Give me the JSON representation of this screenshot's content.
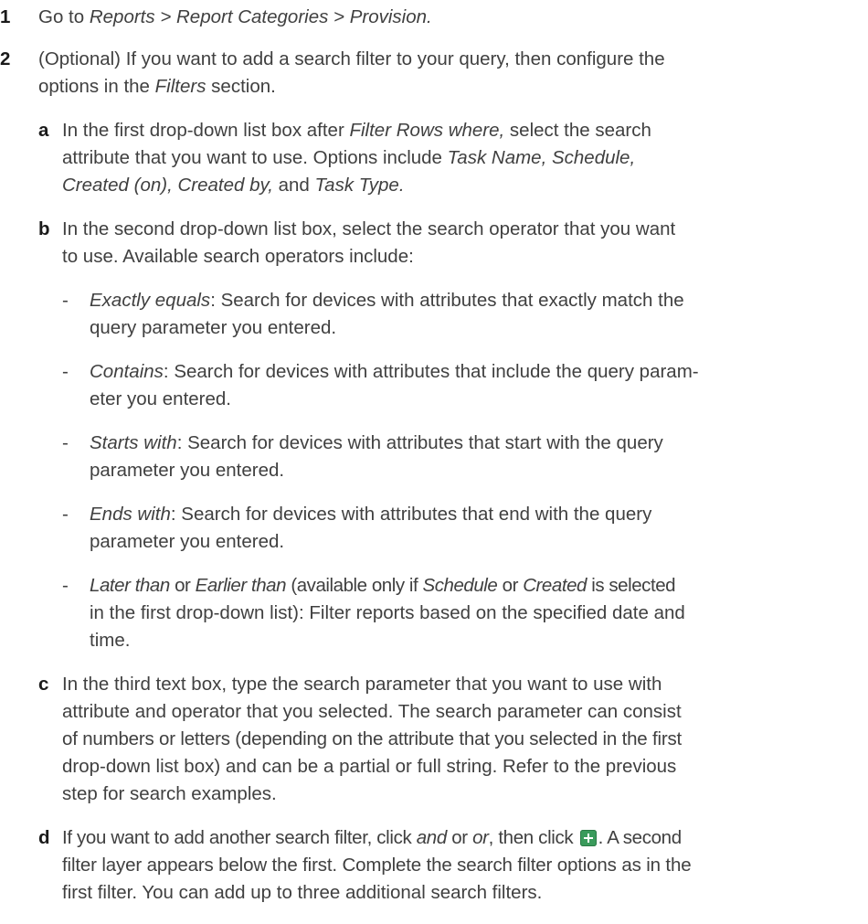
{
  "steps": [
    {
      "number": "1",
      "parts": [
        "Go to ",
        "Reports > Report Categories > Provision."
      ]
    },
    {
      "number": "2",
      "line1": "(Optional) If you want to add a search filter to your query, then configure the",
      "line2_a": "options in the ",
      "line2_b": "Filters",
      "line2_c": " section."
    }
  ],
  "substeps": {
    "a": {
      "label": "a",
      "l1_a": "In the first drop-down list box after ",
      "l1_b": "Filter Rows where,",
      "l1_c": " select the search",
      "l2_a": "attribute that you want to use. Options include ",
      "l2_b": "Task Name, Schedule,",
      "l3_a": "Created (on), Created by,",
      "l3_b": " and ",
      "l3_c": "Task Type."
    },
    "b": {
      "label": "b",
      "l1": "In the second drop-down list box, select the search operator that you want",
      "l2": "to use. Available search operators include:"
    },
    "c": {
      "label": "c",
      "l1": "In the third text box, type the search parameter that you want to use with",
      "l2": "attribute and operator that you selected. The search parameter can consist",
      "l3": "of numbers or letters (depending on the attribute that you selected in the first",
      "l4": "drop-down list box) and can be a partial or full string. Refer to the previous",
      "l5": "step for search examples."
    },
    "d": {
      "label": "d",
      "l1_a": "If you want to add another search filter, click ",
      "l1_b": "and",
      "l1_c": " or ",
      "l1_d": "or",
      "l1_e": ", then click ",
      "l1_f": ". A second",
      "l2": "filter layer appears below the first. Complete the search filter options as in the",
      "l3": "first filter. You can add up to three additional search filters."
    }
  },
  "operators": [
    {
      "dash": "-",
      "name": "Exactly equals",
      "l1": ": Search for devices with attributes that exactly match the",
      "l2": "query parameter you entered."
    },
    {
      "dash": "-",
      "name": "Contains",
      "l1": ": Search for devices with attributes that include the query param-",
      "l2": "eter you entered."
    },
    {
      "dash": "-",
      "name": "Starts with",
      "l1": ": Search for devices with attributes that start with the query",
      "l2": "parameter you entered."
    },
    {
      "dash": "-",
      "name": "Ends with",
      "l1": ": Search for devices with attributes that end with the query",
      "l2": "parameter you entered."
    },
    {
      "dash": "-",
      "name": "Later than",
      "or": " or ",
      "name2": "Earlier than",
      "mid1": " (available only if ",
      "sched": "Schedule",
      "or2": " or ",
      "created": "Created",
      "mid2": " is selected",
      "l2": "in the first drop-down list): Filter reports based on the specified date and",
      "l3": "time."
    }
  ],
  "icons": {
    "add_filter": "add-filter-icon"
  },
  "colors": {
    "icon_green": "#3a9b5c",
    "text": "#404040"
  }
}
